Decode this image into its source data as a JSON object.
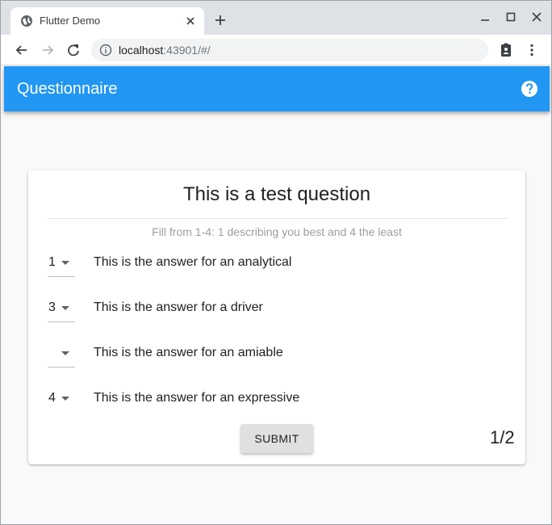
{
  "browser": {
    "tab_title": "Flutter Demo",
    "url_host": "localhost",
    "url_rest": ":43901/#/"
  },
  "appbar": {
    "title": "Questionnaire",
    "color": "#2196f3",
    "help_icon": "help-circle-icon"
  },
  "question": {
    "title": "This is a test question",
    "hint": "Fill from 1-4: 1 describing you best and 4 the least",
    "answers": [
      {
        "selected": "1",
        "text": "This is the answer for an analytical"
      },
      {
        "selected": "3",
        "text": "This is the answer for a driver"
      },
      {
        "selected": "",
        "text": "This is the answer for an amiable"
      },
      {
        "selected": "4",
        "text": "This is the answer for an expressive"
      }
    ],
    "submit_label": "SUBMIT",
    "page_indicator": "1/2"
  }
}
